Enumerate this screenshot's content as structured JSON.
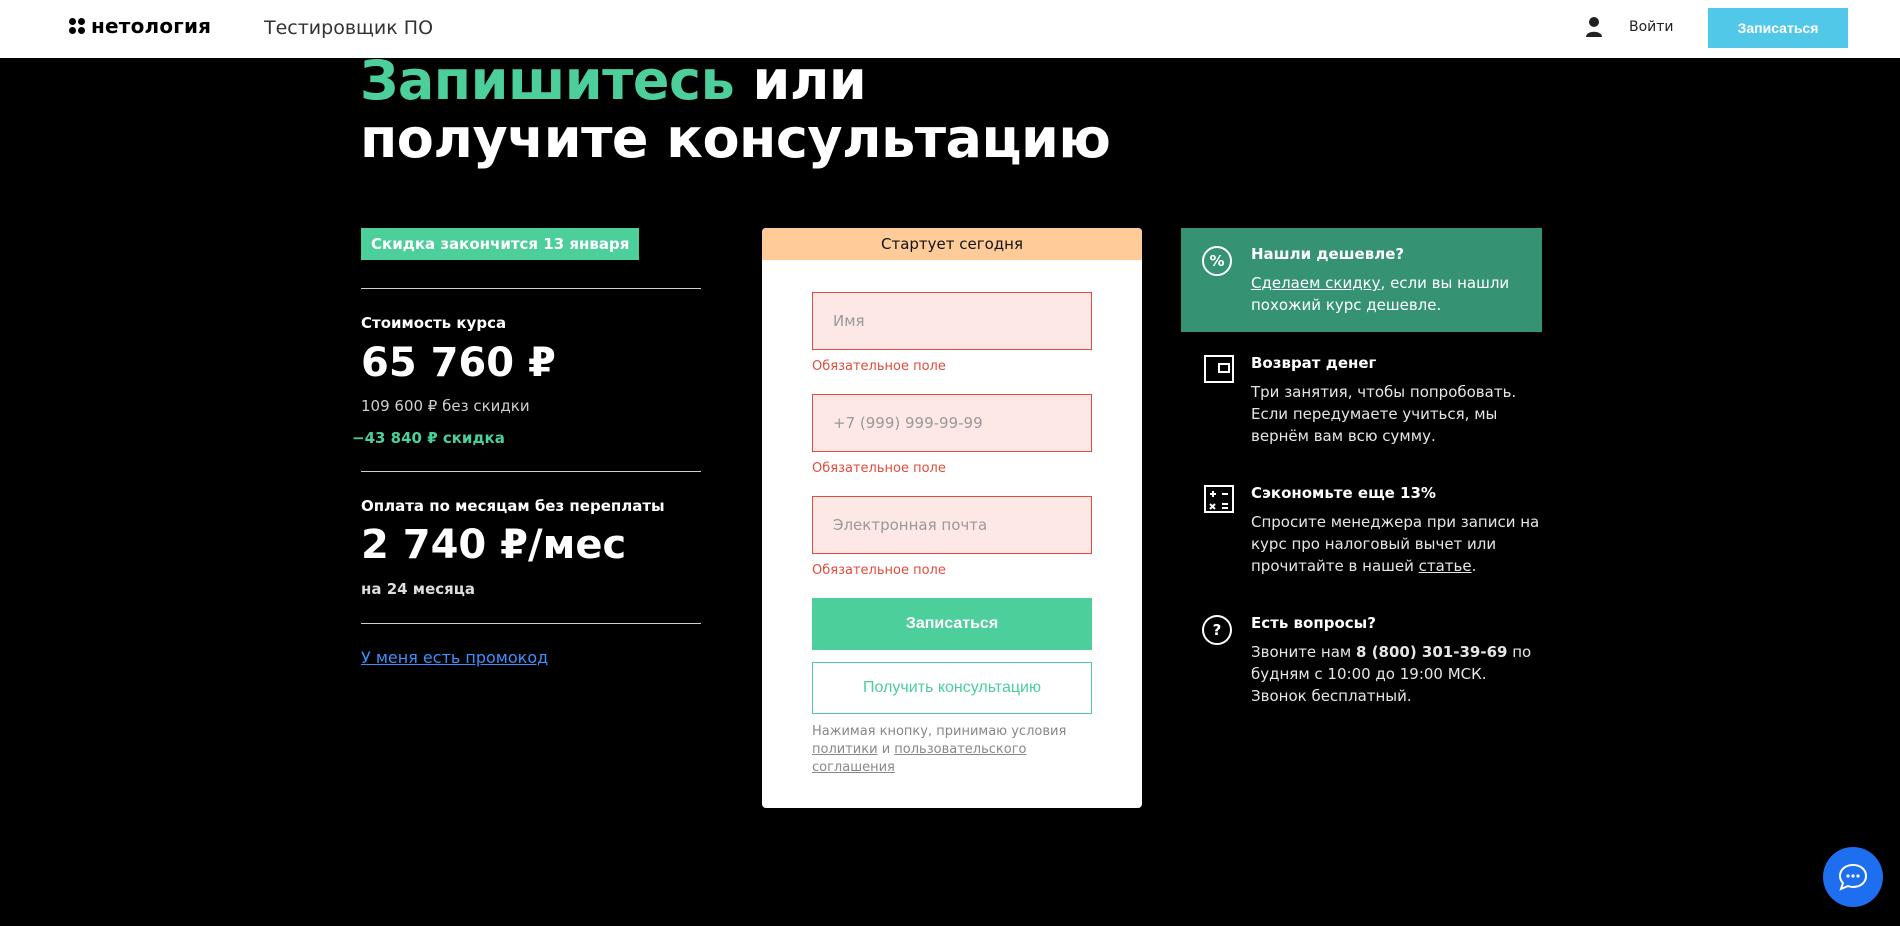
{
  "header": {
    "logo_text": "нетология",
    "course_name": "Тестировщик ПО",
    "login_label": "Войти",
    "signup_label": "Записаться"
  },
  "heading": {
    "accent": "Запишитесь",
    "rest_line1": " или",
    "line2": "получите консультацию"
  },
  "pricing": {
    "deadline_badge": "Скидка закончится 13 января",
    "cost_label": "Стоимость курса",
    "price": "65 760 ₽",
    "old_price": "109 600 ₽ без скидки",
    "discount": "−43 840 ₽ скидка",
    "monthly_label": "Оплата по месяцам без переплаты",
    "monthly_price": "2 740 ₽/мес",
    "monthly_term": "на 24 месяца",
    "promo_link": "У меня есть промокод"
  },
  "form": {
    "banner": "Стартует сегодня",
    "name_placeholder": "Имя",
    "phone_placeholder": "+7 (999) 999-99-99",
    "email_placeholder": "Электронная почта",
    "required_error": "Обязательное поле",
    "submit_label": "Записаться",
    "consult_label": "Получить консультацию",
    "note_prefix": "Нажимая кнопку, принимаю условия",
    "note_link_policy": "политики",
    "note_and": "и",
    "note_link_agreement_1": "пользовательского",
    "note_link_agreement_2": "соглашения"
  },
  "info": {
    "cheaper_title": "Нашли дешевле?",
    "cheaper_link": "Сделаем скидку",
    "cheaper_text_1": ", если вы нашли",
    "cheaper_text_2": "похожий курс дешевле.",
    "refund_title": "Возврат денег",
    "refund_text": "Три занятия, чтобы попробовать. Если передумаете учиться, мы вернём вам всю сумму.",
    "save_title": "Сэкономьте еще 13%",
    "save_text": "Спросите менеджера при записи на курс про налоговый вычет или прочитайте в нашей",
    "save_link": "статье",
    "save_end": ".",
    "questions_title": "Есть вопросы?",
    "questions_text_1": "Звоните нам",
    "questions_phone": "8 (800) 301-39-69",
    "questions_text_2": "по будням с 10:00 до 19:00 МСК. Звонок бесплатный."
  },
  "colors": {
    "accent_green": "#4ccf9a",
    "header_button": "#52c8e8",
    "error_red": "#e24c3c",
    "chat_blue": "#1e6ef0"
  }
}
